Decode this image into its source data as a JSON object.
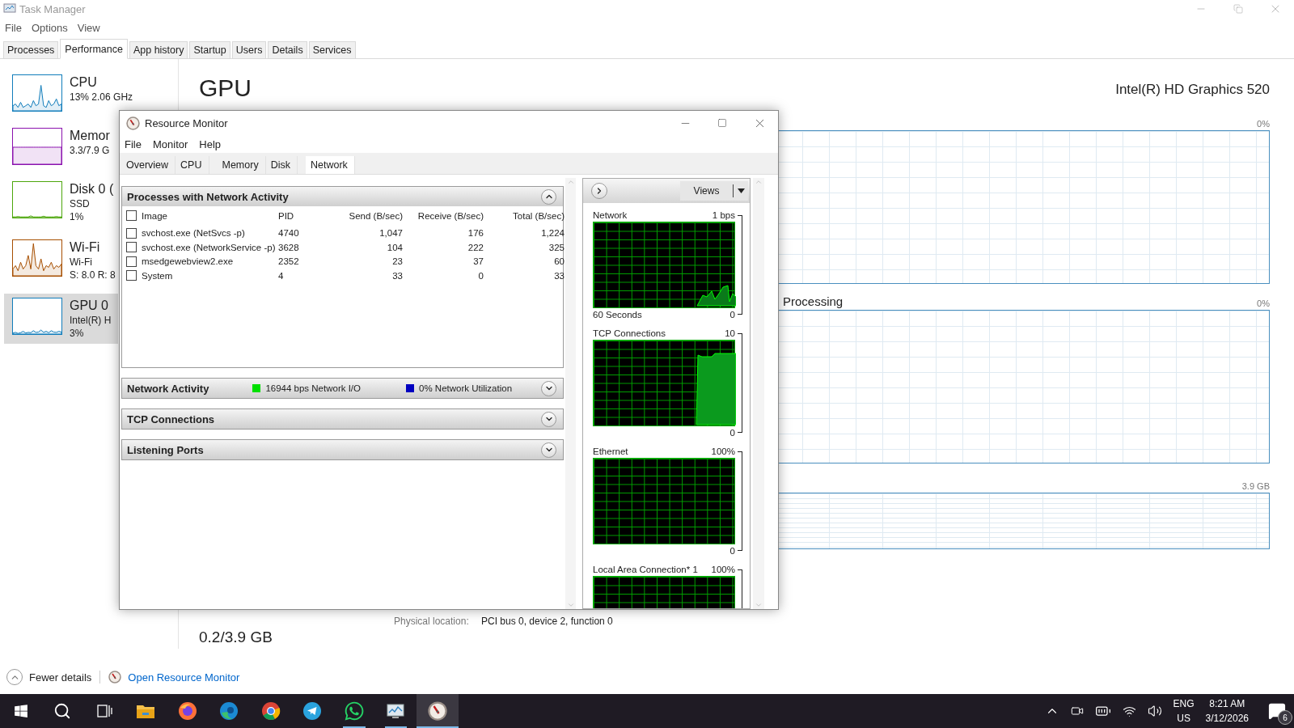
{
  "task_manager": {
    "title": "Task Manager",
    "menu": [
      "File",
      "Options",
      "View"
    ],
    "tabs": [
      {
        "label": "Processes",
        "selected": false
      },
      {
        "label": "Performance",
        "selected": true
      },
      {
        "label": "App history",
        "selected": false
      },
      {
        "label": "Startup",
        "selected": false
      },
      {
        "label": "Users",
        "selected": false
      },
      {
        "label": "Details",
        "selected": false
      },
      {
        "label": "Services",
        "selected": false
      }
    ],
    "sidebar": [
      {
        "name": "CPU",
        "lines": [
          "13% 2.06 GHz"
        ],
        "color": "#117dbb",
        "selected": false
      },
      {
        "name": "Memor",
        "lines": [
          "3.3/7.9 G"
        ],
        "color": "#8b12ae",
        "selected": false
      },
      {
        "name": "Disk 0 (",
        "lines": [
          "SSD",
          "1%"
        ],
        "color": "#4da60c",
        "selected": false
      },
      {
        "name": "Wi-Fi",
        "lines": [
          "Wi-Fi",
          "S: 8.0 R: 8"
        ],
        "color": "#a74f01",
        "selected": false
      },
      {
        "name": "GPU 0",
        "lines": [
          "Intel(R) H",
          "3%"
        ],
        "color": "#117dbb",
        "selected": true
      }
    ],
    "heading": "GPU",
    "adapter": "Intel(R) HD Graphics 520",
    "graphs": [
      {
        "max": "0%"
      },
      {
        "label": "Processing",
        "max": "0%"
      },
      {
        "max": "3.9 GB"
      }
    ],
    "memory_value": "0.2/3.9 GB",
    "location_label": "Physical location:",
    "location": "PCI bus 0, device 2, function 0",
    "footer": {
      "fewer_details": "Fewer details",
      "link": "Open Resource Monitor"
    }
  },
  "resource_monitor": {
    "title": "Resource Monitor",
    "menu": [
      "File",
      "Monitor",
      "Help"
    ],
    "tabs": [
      {
        "label": "Overview",
        "selected": false
      },
      {
        "label": "CPU",
        "selected": false
      },
      {
        "label": "Memory",
        "selected": false
      },
      {
        "label": "Disk",
        "selected": false
      },
      {
        "label": "Network",
        "selected": true
      }
    ],
    "processes": {
      "title": "Processes with Network Activity",
      "expanded": true,
      "header_checked": false,
      "columns": [
        "Image",
        "PID",
        "Send (B/sec)",
        "Receive (B/sec)",
        "Total (B/sec)"
      ],
      "rows": [
        {
          "checked": false,
          "cells": [
            "svchost.exe (NetSvcs -p)",
            "4740",
            "1,047",
            "176",
            "1,224"
          ]
        },
        {
          "checked": false,
          "cells": [
            "svchost.exe (NetworkService -p)",
            "3628",
            "104",
            "222",
            "325"
          ]
        },
        {
          "checked": false,
          "cells": [
            "msedgewebview2.exe",
            "2352",
            "23",
            "37",
            "60"
          ]
        },
        {
          "checked": false,
          "cells": [
            "System",
            "4",
            "33",
            "0",
            "33"
          ]
        }
      ]
    },
    "sections": [
      {
        "title": "Network Activity",
        "expanded": false,
        "legend": [
          {
            "text": "16944 bps Network I/O",
            "color": "#00e000"
          },
          {
            "text": "0% Network Utilization",
            "color": "#0000c0"
          }
        ]
      },
      {
        "title": "TCP Connections",
        "expanded": false
      },
      {
        "title": "Listening Ports",
        "expanded": false
      }
    ],
    "views_button": "Views",
    "graphs": [
      {
        "title": "Network",
        "max": "1 bps",
        "caption": "60 Seconds",
        "min": "0"
      },
      {
        "title": "TCP Connections",
        "max": "10",
        "min": "0"
      },
      {
        "title": "Ethernet",
        "max": "100%",
        "min": "0"
      },
      {
        "title": "Local Area Connection* 1",
        "max": "100%"
      }
    ]
  },
  "taskbar": {
    "apps": [
      {
        "kind": "start",
        "running": false,
        "active": false
      },
      {
        "kind": "search",
        "running": false,
        "active": false
      },
      {
        "kind": "task_view",
        "running": false,
        "active": false
      },
      {
        "kind": "files",
        "running": false,
        "active": false
      },
      {
        "kind": "firefox",
        "running": false,
        "active": false
      },
      {
        "kind": "edge",
        "running": false,
        "active": false
      },
      {
        "kind": "chrome",
        "running": false,
        "active": false
      },
      {
        "kind": "telegram",
        "running": false,
        "active": false
      },
      {
        "kind": "whatsapp",
        "running": true,
        "active": false
      },
      {
        "kind": "task_manager",
        "running": true,
        "active": false
      },
      {
        "kind": "resource_monitor",
        "running": true,
        "active": true
      }
    ],
    "language": [
      "ENG",
      "US"
    ],
    "time": "8:21 AM",
    "date": "3/12/2026",
    "notifications": "6"
  }
}
